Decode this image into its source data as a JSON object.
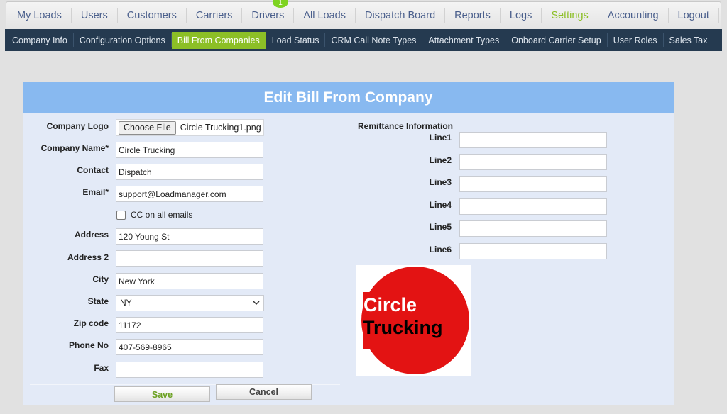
{
  "top_nav": {
    "items": [
      {
        "label": "My Loads"
      },
      {
        "label": "Users"
      },
      {
        "label": "Customers"
      },
      {
        "label": "Carriers"
      },
      {
        "label": "Drivers"
      },
      {
        "label": "All Loads"
      },
      {
        "label": "Dispatch Board"
      },
      {
        "label": "Reports"
      },
      {
        "label": "Logs"
      },
      {
        "label": "Settings",
        "active": true
      },
      {
        "label": "Accounting"
      },
      {
        "label": "Logout"
      }
    ],
    "notification_badge": "1"
  },
  "sub_nav": {
    "items": [
      {
        "label": "Company Info"
      },
      {
        "label": "Configuration Options"
      },
      {
        "label": "Bill From Companies",
        "active": true
      },
      {
        "label": "Load Status"
      },
      {
        "label": "CRM Call Note Types"
      },
      {
        "label": "Attachment Types"
      },
      {
        "label": "Onboard Carrier Setup"
      },
      {
        "label": "User Roles"
      },
      {
        "label": "Sales Tax"
      }
    ]
  },
  "form": {
    "title": "Edit Bill From Company",
    "company_logo": {
      "label": "Company Logo",
      "button": "Choose File",
      "file_name": "Circle Trucking1.png"
    },
    "company_name": {
      "label": "Company Name*",
      "value": "Circle Trucking"
    },
    "contact": {
      "label": "Contact",
      "value": "Dispatch"
    },
    "email": {
      "label": "Email*",
      "value": "support@Loadmanager.com"
    },
    "cc_all": {
      "label": "CC on all emails",
      "checked": false
    },
    "address": {
      "label": "Address",
      "value": "120 Young St"
    },
    "address2": {
      "label": "Address 2",
      "value": ""
    },
    "city": {
      "label": "City",
      "value": "New York"
    },
    "state": {
      "label": "State",
      "value": "NY"
    },
    "zip": {
      "label": "Zip code",
      "value": "11172"
    },
    "phone": {
      "label": "Phone No",
      "value": "407-569-8965"
    },
    "fax": {
      "label": "Fax",
      "value": ""
    },
    "remittance": {
      "heading": "Remittance Information",
      "lines": [
        {
          "label": "Line1",
          "value": ""
        },
        {
          "label": "Line2",
          "value": ""
        },
        {
          "label": "Line3",
          "value": ""
        },
        {
          "label": "Line4",
          "value": ""
        },
        {
          "label": "Line5",
          "value": ""
        },
        {
          "label": "Line6",
          "value": ""
        }
      ]
    },
    "logo_preview": {
      "line1": "Circle",
      "line2": "Trucking",
      "circle_color": "#e31313"
    },
    "save_label": "Save",
    "cancel_label": "Cancel"
  },
  "colors": {
    "accent_green": "#8cbf26",
    "subnav_bg": "#253a50",
    "header_blue": "#88b9f0",
    "panel_bg": "#e3eaf7"
  }
}
